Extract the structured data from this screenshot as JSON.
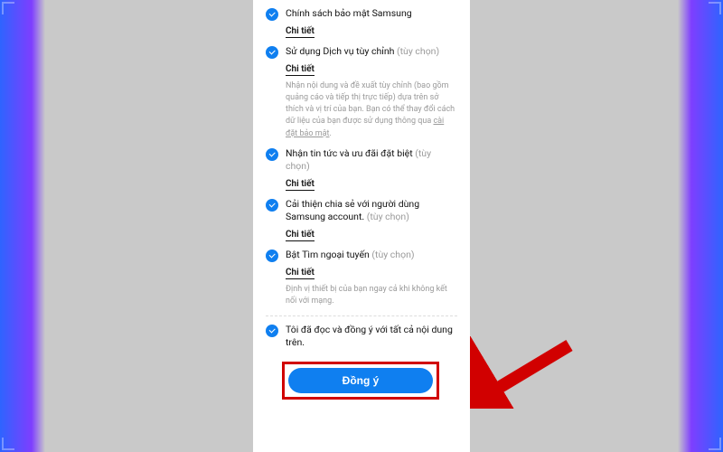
{
  "items": [
    {
      "title": "Chính sách bảo mật Samsung",
      "optional": "",
      "detail": "Chi tiết",
      "desc": ""
    },
    {
      "title": "Sử dụng Dịch vụ tùy chỉnh",
      "optional": " (tùy chọn) ",
      "detail": "Chi tiết",
      "desc": "Nhận nội dung và đề xuất tùy chỉnh (bao gồm quảng cáo và tiếp thị trực tiếp) dựa trên sở thích và vị trí của bạn. Bạn có thể thay đổi cách dữ liệu của bạn được sử dụng thông qua ",
      "desc_link": "cài đặt bảo mật"
    },
    {
      "title": "Nhận tin tức và ưu đãi đặt biệt",
      "optional": " (tùy chọn) ",
      "detail": "Chi tiết",
      "desc": ""
    },
    {
      "title": "Cải thiện chia sẻ với người dùng Samsung account.",
      "optional": " (tùy chọn) ",
      "detail": "Chi tiết",
      "desc": ""
    },
    {
      "title": "Bật Tìm ngoại tuyến",
      "optional": " (tùy chọn) ",
      "detail": "Chi tiết",
      "desc": "Định vị thiết bị của bạn ngay cả khi không kết nối với mạng."
    }
  ],
  "consent": {
    "text": "Tôi đã đọc và đồng ý với tất cả nội dung trên."
  },
  "agree_button": "Đồng ý"
}
